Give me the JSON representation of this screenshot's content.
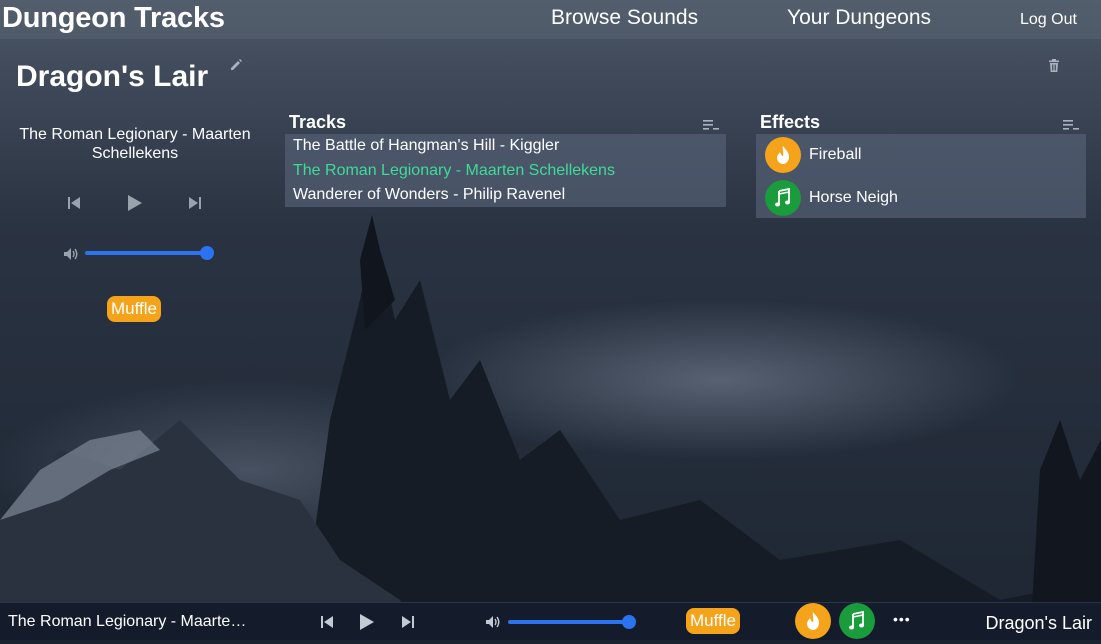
{
  "topbar": {
    "brand": "Dungeon Tracks",
    "nav": {
      "browse": "Browse Sounds",
      "dungeons": "Your Dungeons",
      "logout": "Log Out"
    }
  },
  "dungeon": {
    "title": "Dragon's Lair"
  },
  "player": {
    "now_playing": "The Roman Legionary - Maarten Schellekens",
    "volume": 1.0,
    "muffle_label": "Muffle"
  },
  "tracks": {
    "title": "Tracks",
    "items": [
      {
        "label": "The Battle of Hangman's Hill - Kiggler",
        "active": false
      },
      {
        "label": "The Roman Legionary - Maarten Schellekens",
        "active": true
      },
      {
        "label": "Wanderer of Wonders - Philip Ravenel",
        "active": false
      }
    ]
  },
  "effects": {
    "title": "Effects",
    "items": [
      {
        "label": "Fireball",
        "icon": "flame-icon",
        "color": "#f5a31a"
      },
      {
        "label": "Horse Neigh",
        "icon": "music-note-icon",
        "color": "#1a9b3c"
      }
    ]
  },
  "bottombar": {
    "track": "The Roman Legionary - Maarten Schellekens",
    "volume": 1.0,
    "muffle_label": "Muffle",
    "more_label": "•••",
    "dungeon": "Dragon's Lair"
  },
  "colors": {
    "accent_blue": "#2b73f0",
    "muffle_orange": "#f5a31a",
    "active_track_green": "#3ddc97",
    "effect_green": "#1a9b3c"
  }
}
